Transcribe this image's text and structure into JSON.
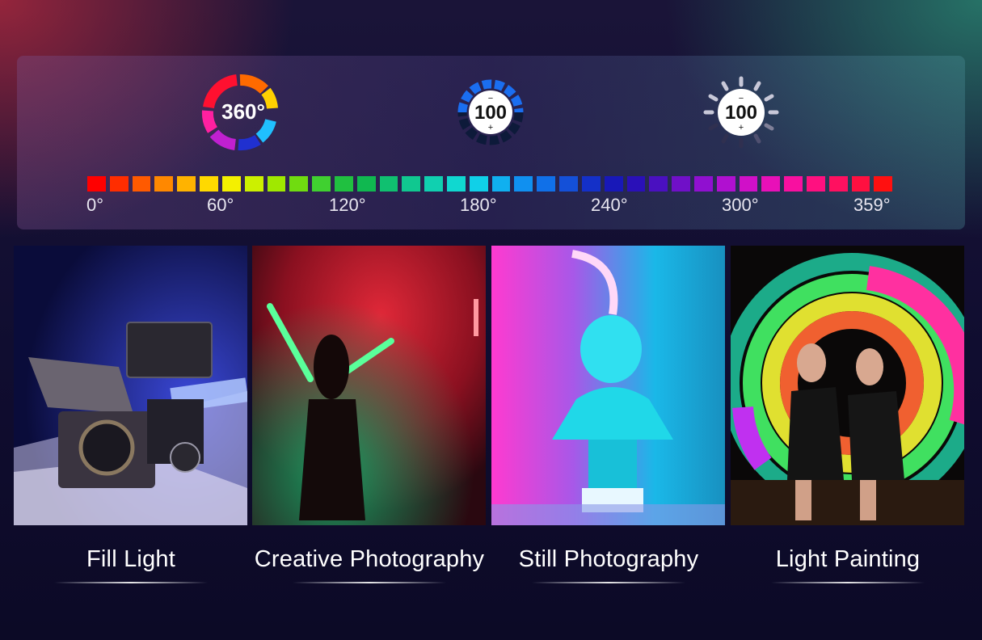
{
  "specs": {
    "hue": {
      "icon": "color-wheel-icon",
      "label": "360°"
    },
    "brightness": {
      "icon": "brightness-dial-icon",
      "label": "100",
      "minus": "−",
      "plus": "+"
    },
    "saturation": {
      "icon": "sun-dial-icon",
      "label": "100",
      "minus": "−",
      "plus": "+"
    }
  },
  "hue_scale": {
    "segments": [
      "#ff0000",
      "#ff2d00",
      "#ff5a00",
      "#ff8800",
      "#ffb300",
      "#ffd900",
      "#f4f000",
      "#ccf000",
      "#a0e800",
      "#70dc10",
      "#40d030",
      "#20c040",
      "#10b850",
      "#10c070",
      "#10c890",
      "#10d0b0",
      "#10d8d0",
      "#10d0e8",
      "#10b0f0",
      "#1090f0",
      "#1070e8",
      "#1450d8",
      "#1430c8",
      "#1818b8",
      "#2a10b8",
      "#4a10c0",
      "#7010c8",
      "#9010d0",
      "#b010d0",
      "#d010c8",
      "#e810b8",
      "#f810a0",
      "#ff1080",
      "#ff1060",
      "#ff1040",
      "#ff1010"
    ],
    "ticks": [
      "0°",
      "60°",
      "120°",
      "180°",
      "240°",
      "300°",
      "359°"
    ]
  },
  "scenes": [
    {
      "caption": "Fill Light",
      "icon": "camera-rig-photo"
    },
    {
      "caption": "Creative Photography",
      "icon": "light-wands-photo"
    },
    {
      "caption": "Still Photography",
      "icon": "bust-statue-photo"
    },
    {
      "caption": "Light Painting",
      "icon": "light-painting-photo"
    }
  ],
  "colors": {
    "background": "#120f32",
    "accent_red": "#aa283c",
    "accent_teal": "#28826e"
  }
}
